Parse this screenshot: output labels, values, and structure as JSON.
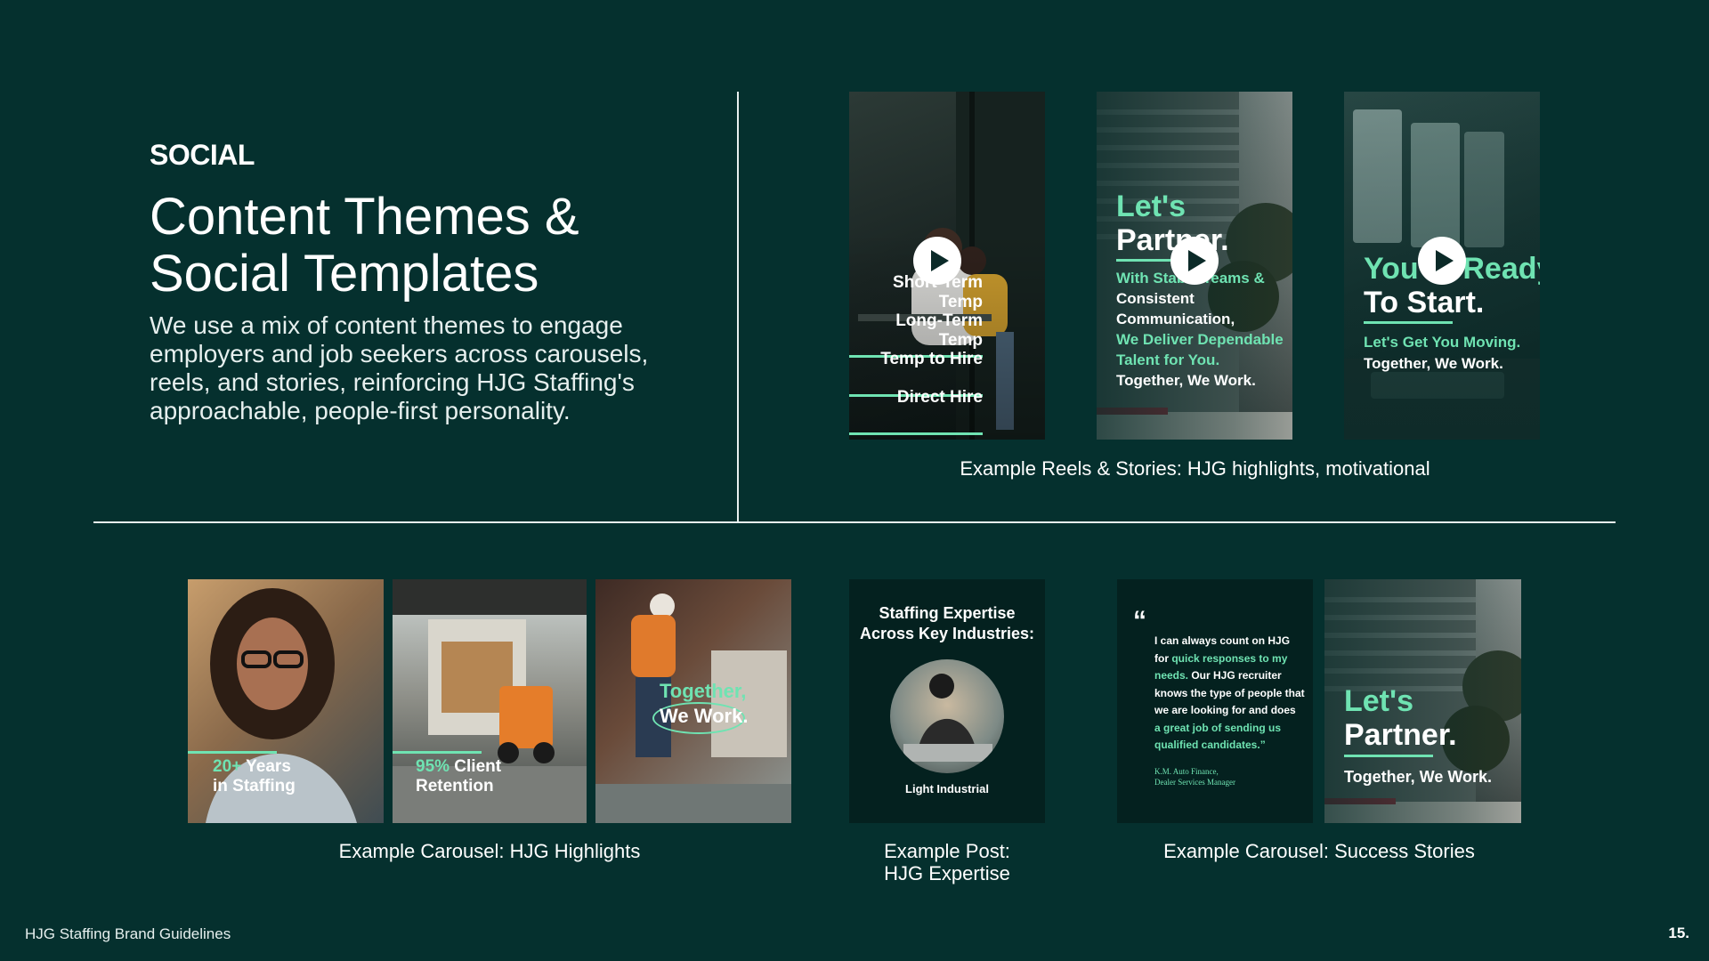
{
  "header": {
    "eyebrow": "SOCIAL",
    "title_line1": "Content Themes &",
    "title_line2": "Social Templates",
    "intro": "We use a mix of content themes to engage employers and job seekers across carousels, reels, and stories, reinforcing HJG Staffing's approachable, people-first personality."
  },
  "reels": {
    "caption": "Example Reels & Stories: HJG highlights, motivational",
    "reel1": {
      "items": [
        "Short-Term Temp",
        "Long-Term Temp",
        "Temp to Hire",
        "Direct Hire"
      ]
    },
    "reel2": {
      "heading1": "Let's",
      "heading2": "Partner.",
      "line1": "With Stable Teams &",
      "line2": "Consistent",
      "line3": "Communication,",
      "line4": "We Deliver Dependable",
      "line5": "Talent for You.",
      "line6": "Together, We Work."
    },
    "reel3": {
      "heading1": "You're Ready,",
      "heading2": "To Start.",
      "line1": "Let's Get You Moving.",
      "line2": "Together, We Work."
    }
  },
  "carousel_highlights": {
    "caption": "Example Carousel: HJG Highlights",
    "slide1_mint": "20+",
    "slide1_rest": " Years",
    "slide1_line2": "in Staffing",
    "slide2_mint": "95%",
    "slide2_rest": " Client",
    "slide2_line2": "Retention",
    "slide3_line1": "Together,",
    "slide3_line2": "We Work."
  },
  "post_expertise": {
    "caption_line1": "Example Post:",
    "caption_line2": "HJG Expertise",
    "heading_line1": "Staffing Expertise",
    "heading_line2": "Across Key Industries:",
    "industry": "Light Industrial"
  },
  "carousel_success": {
    "caption": "Example Carousel: Success Stories",
    "quote_mark": "“",
    "q1": "I can always count on HJG",
    "q2a": "for ",
    "q2b": "quick responses to my",
    "q3a": "needs.",
    "q3b": " Our HJG recruiter",
    "q4": "knows the type of people that",
    "q5": "we are looking for and does",
    "q6": "a great job of sending us",
    "q7": "qualified candidates.”",
    "attrib1": "K.M. Auto Finance,",
    "attrib2": "Dealer Services Manager",
    "slide2_heading1": "Let's",
    "slide2_heading2": "Partner.",
    "slide2_line": "Together, We Work."
  },
  "footer": {
    "left": "HJG Staffing Brand Guidelines",
    "right": "15."
  },
  "colors": {
    "background": "#05302e",
    "accent_mint": "#6fe3b2",
    "text": "#ffffff"
  }
}
